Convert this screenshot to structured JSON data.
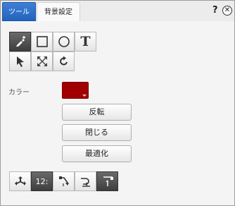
{
  "tabs": [
    {
      "label": "ツール",
      "active": true
    },
    {
      "label": "背景設定",
      "active": false
    }
  ],
  "header": {
    "help_label": "?",
    "close_label": "✕"
  },
  "draw_tools": [
    {
      "name": "pen-plus-icon",
      "selected": true
    },
    {
      "name": "rectangle-icon",
      "selected": false
    },
    {
      "name": "circle-icon",
      "selected": false
    },
    {
      "name": "text-icon",
      "selected": false,
      "glyph": "T"
    },
    {
      "name": "select-arrow-icon",
      "selected": false
    },
    {
      "name": "resize-icon",
      "selected": false
    },
    {
      "name": "rotate-icon",
      "selected": false
    }
  ],
  "color": {
    "label": "カラー",
    "value": "#a00000"
  },
  "buttons": {
    "flip": "反転",
    "close": "閉じる",
    "optimize": "最適化"
  },
  "bottom_tools": [
    {
      "name": "move-split-icon",
      "selected": false
    },
    {
      "name": "numbering-icon",
      "selected": true,
      "glyph": "12:"
    },
    {
      "name": "step-down-icon",
      "selected": false
    },
    {
      "name": "curve-arrow-icon",
      "selected": false
    },
    {
      "name": "flag-number-icon",
      "selected": true
    }
  ]
}
